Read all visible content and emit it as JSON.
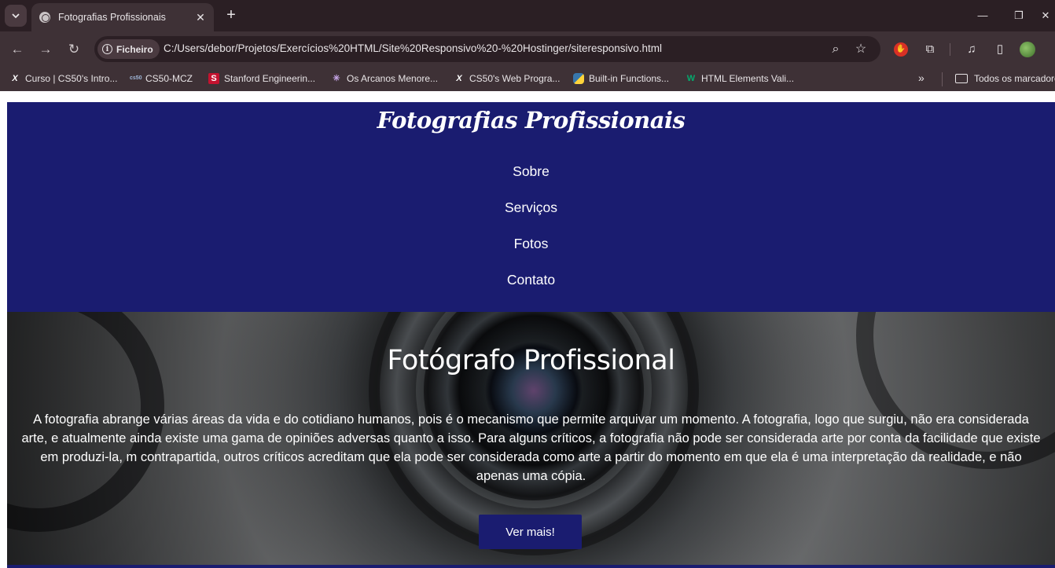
{
  "browser": {
    "tab_title": "Fotografias Profissionais",
    "site_chip": "Ficheiro",
    "url": "C:/Users/debor/Projetos/Exercícios%20HTML/Site%20Responsivo%20-%20Hostinger/siteresponsivo.html",
    "bookmarks": [
      {
        "label": "Curso | CS50's Intro...",
        "icon": "harvardx-icon"
      },
      {
        "label": "CS50-MCZ",
        "icon": "cs50-icon"
      },
      {
        "label": "Stanford Engineerin...",
        "icon": "stanford-icon"
      },
      {
        "label": "Os Arcanos Menore...",
        "icon": "arcanos-icon"
      },
      {
        "label": "CS50's Web Progra...",
        "icon": "harvardx-icon"
      },
      {
        "label": "Built-in Functions...",
        "icon": "python-icon"
      },
      {
        "label": "HTML Elements Vali...",
        "icon": "w3c-icon"
      }
    ],
    "bookmarks_folder": "Todos os marcadores"
  },
  "site": {
    "logo": "Fotografias Profissionais",
    "nav": [
      "Sobre",
      "Serviços",
      "Fotos",
      "Contato"
    ],
    "hero": {
      "title": "Fotógrafo Profissional",
      "text": "A fotografia abrange várias áreas da vida e do cotidiano humanos, pois é o mecanismo que permite arquivar um momento. A fotografia, logo que surgiu, não era considerada arte, e atualmente ainda existe uma gama de opiniões adversas quanto a isso. Para alguns críticos, a fotografia não pode ser considerada arte por conta da facilidade que existe em produzi-la, m contrapartida, outros críticos acreditam que ela pode ser considerada como arte a partir do momento em que ela é uma interpretação da realidade, e não apenas uma cópia.",
      "button": "Ver mais!"
    }
  },
  "colors": {
    "header_bg": "#1a1c70",
    "chrome_dark": "#2b1f24",
    "chrome_mid": "#3e3136"
  }
}
